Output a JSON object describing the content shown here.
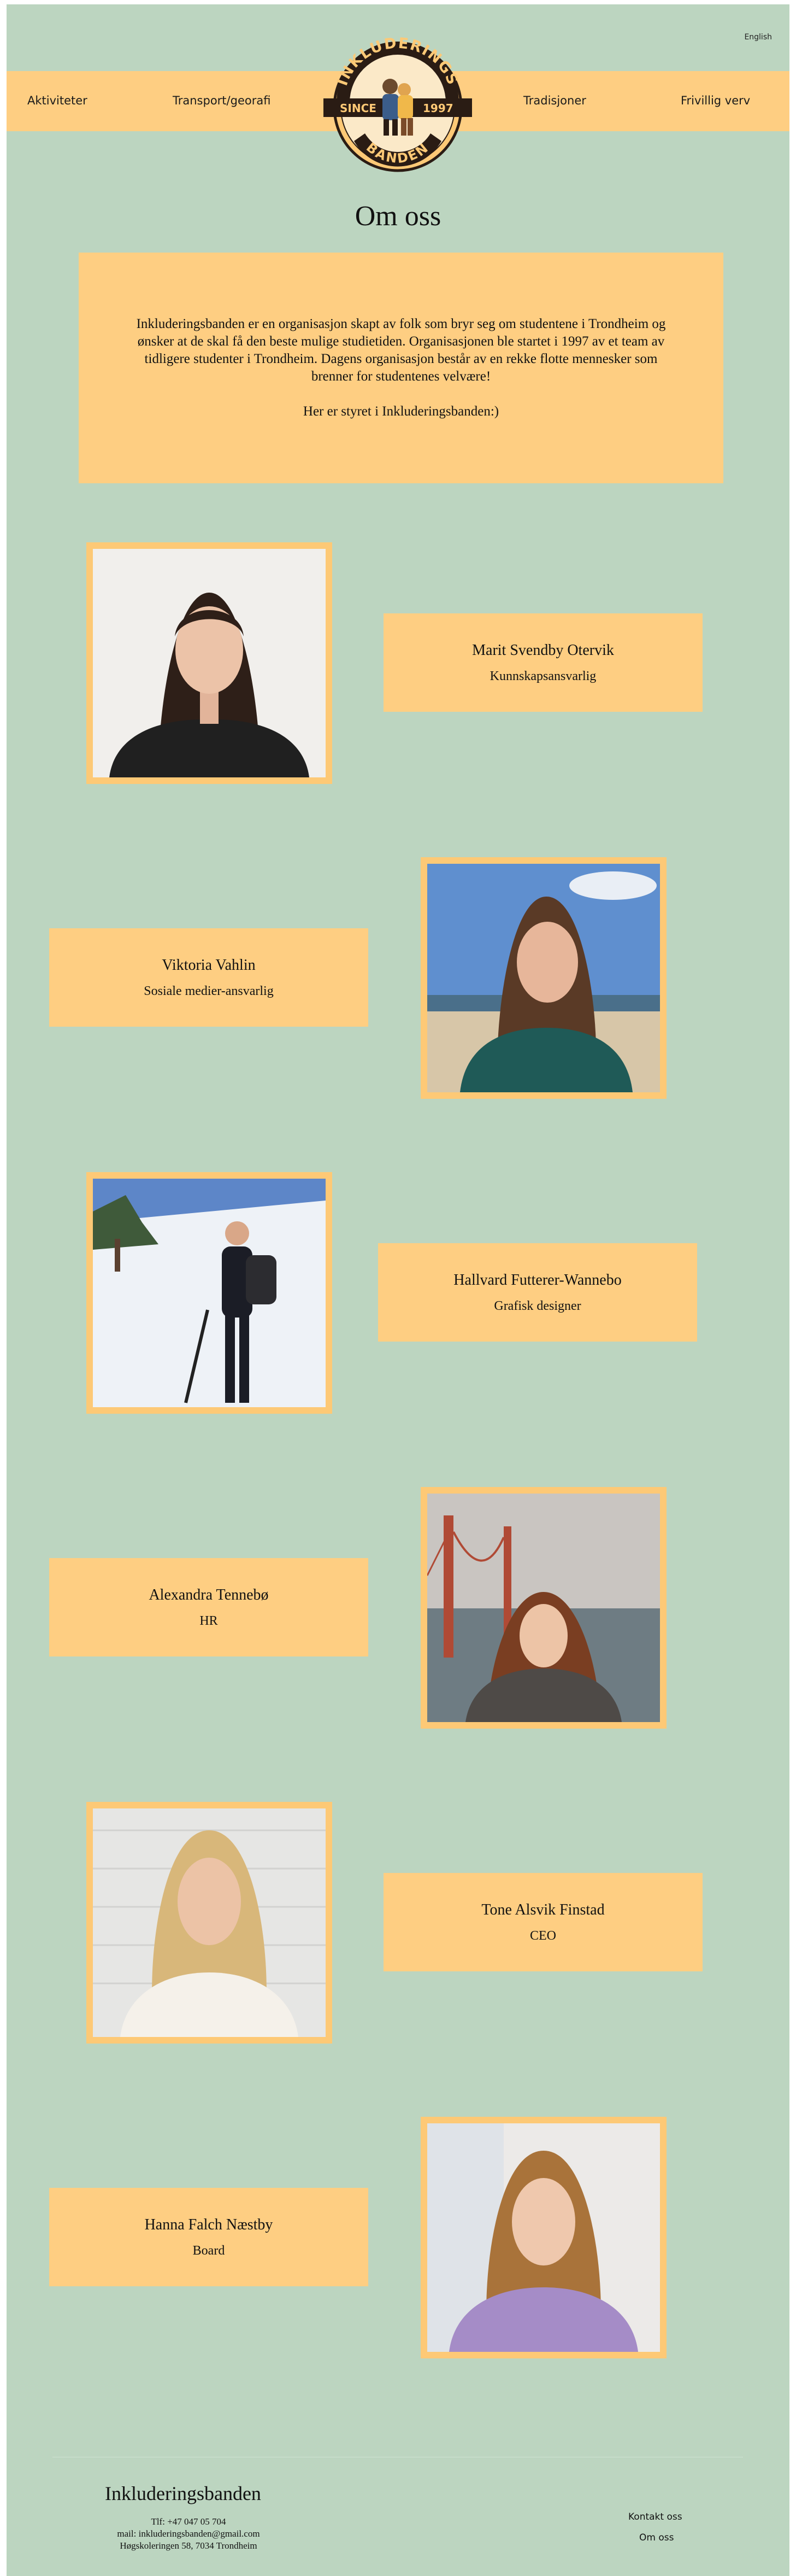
{
  "topbar": {
    "language_link": "English"
  },
  "nav": {
    "items": [
      "Aktiviteter",
      "Transport/georafi",
      "Tradisjoner",
      "Frivillig verv"
    ]
  },
  "logo": {
    "top_text": "INKLUDERINGS",
    "bottom_text": "BANDEN",
    "since_label": "SINCE",
    "year": "1997"
  },
  "page_title": "Om oss",
  "intro": {
    "paragraph": "Inkluderingsbanden er en organisasjon skapt av folk som bryr seg om studentene i Trondheim og ønsker at de skal få den beste mulige studietiden. Organisasjonen ble startet i 1997 av et team av tidligere studenter i Trondheim. Dagens organisasjon består av en rekke flotte mennesker som brenner for studentenes velvære!",
    "board_line": "Her er styret i Inkluderingsbanden:)"
  },
  "members": [
    {
      "name": "Marit Svendby Otervik",
      "role": "Kunnskapsansvarlig"
    },
    {
      "name": "Viktoria Vahlin",
      "role": "Sosiale medier-ansvarlig"
    },
    {
      "name": "Hallvard Futterer-Wannebo",
      "role": "Grafisk designer"
    },
    {
      "name": "Alexandra Tennebø",
      "role": "HR"
    },
    {
      "name": "Tone Alsvik Finstad",
      "role": "CEO"
    },
    {
      "name": "Hanna Falch Næstby",
      "role": "Board"
    }
  ],
  "footer": {
    "brand": "Inkluderingsbanden",
    "phone": "Tlf: +47 047 05 704",
    "email": "mail: inkluderingsbanden@gmail.com",
    "address": "Høgskoleringen 58,  7034 Trondheim",
    "links": [
      "Kontakt oss",
      "Om oss"
    ]
  },
  "colors": {
    "background": "#bcd5c0",
    "accent": "#fece82",
    "photo_frame": "#fdc976",
    "logo_dark": "#2a1c14"
  }
}
